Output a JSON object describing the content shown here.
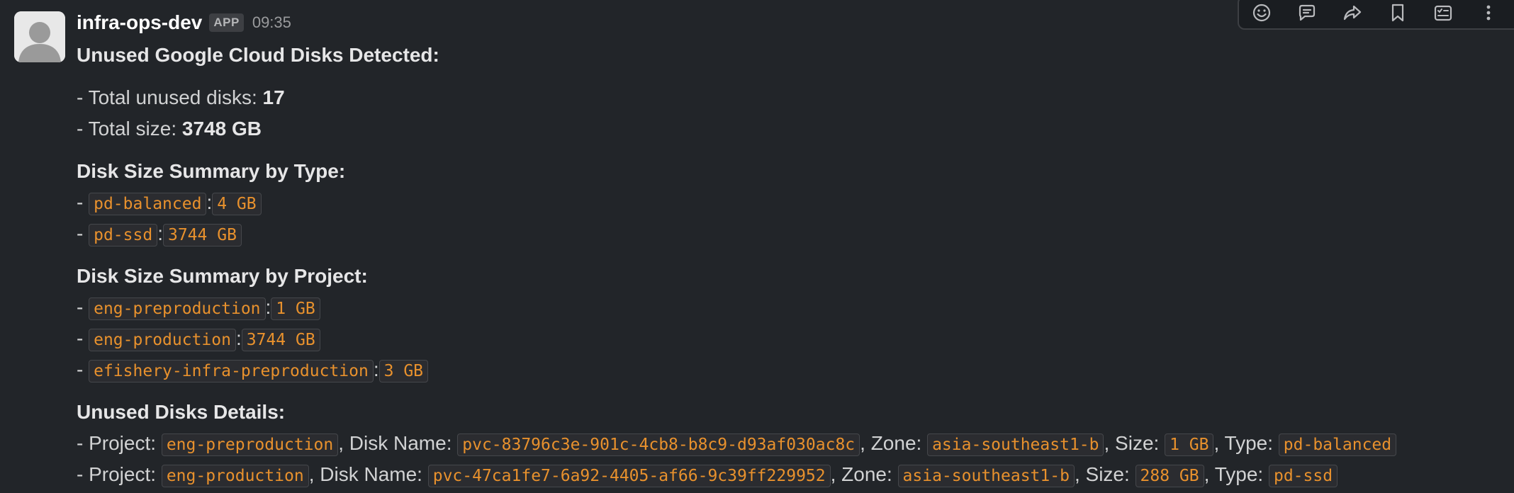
{
  "message": {
    "sender": "infra-ops-dev",
    "badge": "APP",
    "time": "09:35",
    "title": "Unused Google Cloud Disks Detected:",
    "total_disks_label": "- Total unused disks:",
    "total_disks": "17",
    "total_size_label": "- Total size:",
    "total_size": "3748 GB",
    "type_heading": "Disk Size Summary by Type:",
    "types": [
      {
        "name": "pd-balanced",
        "size": "4 GB"
      },
      {
        "name": "pd-ssd",
        "size": "3744 GB"
      }
    ],
    "project_heading": "Disk Size Summary by Project:",
    "projects": [
      {
        "name": "eng-preproduction",
        "size": "1 GB"
      },
      {
        "name": "eng-production",
        "size": "3744 GB"
      },
      {
        "name": "efishery-infra-preproduction",
        "size": "3 GB"
      }
    ],
    "details_heading": "Unused Disks Details:",
    "details": [
      {
        "project": "eng-preproduction",
        "disk": "pvc-83796c3e-901c-4cb8-b8c9-d93af030ac8c",
        "zone": "asia-southeast1-b",
        "size": "1 GB",
        "type": "pd-balanced"
      },
      {
        "project": "eng-production",
        "disk": "pvc-47ca1fe7-6a92-4405-af66-9c39ff229952",
        "zone": "asia-southeast1-b",
        "size": "288 GB",
        "type": "pd-ssd"
      }
    ],
    "labels": {
      "dash": "- ",
      "colon": ": ",
      "project": "- Project: ",
      "disk_name": ", Disk Name: ",
      "zone": ", Zone: ",
      "size": ", Size: ",
      "type": ", Type: "
    }
  },
  "toolbar": {
    "icons": [
      "emoji-reaction-icon",
      "reply-thread-icon",
      "share-forward-icon",
      "bookmark-icon",
      "add-task-icon",
      "more-actions-icon"
    ]
  },
  "colors": {
    "background": "#222529",
    "code_text": "#e8912d",
    "code_bg": "#2b2c30"
  }
}
